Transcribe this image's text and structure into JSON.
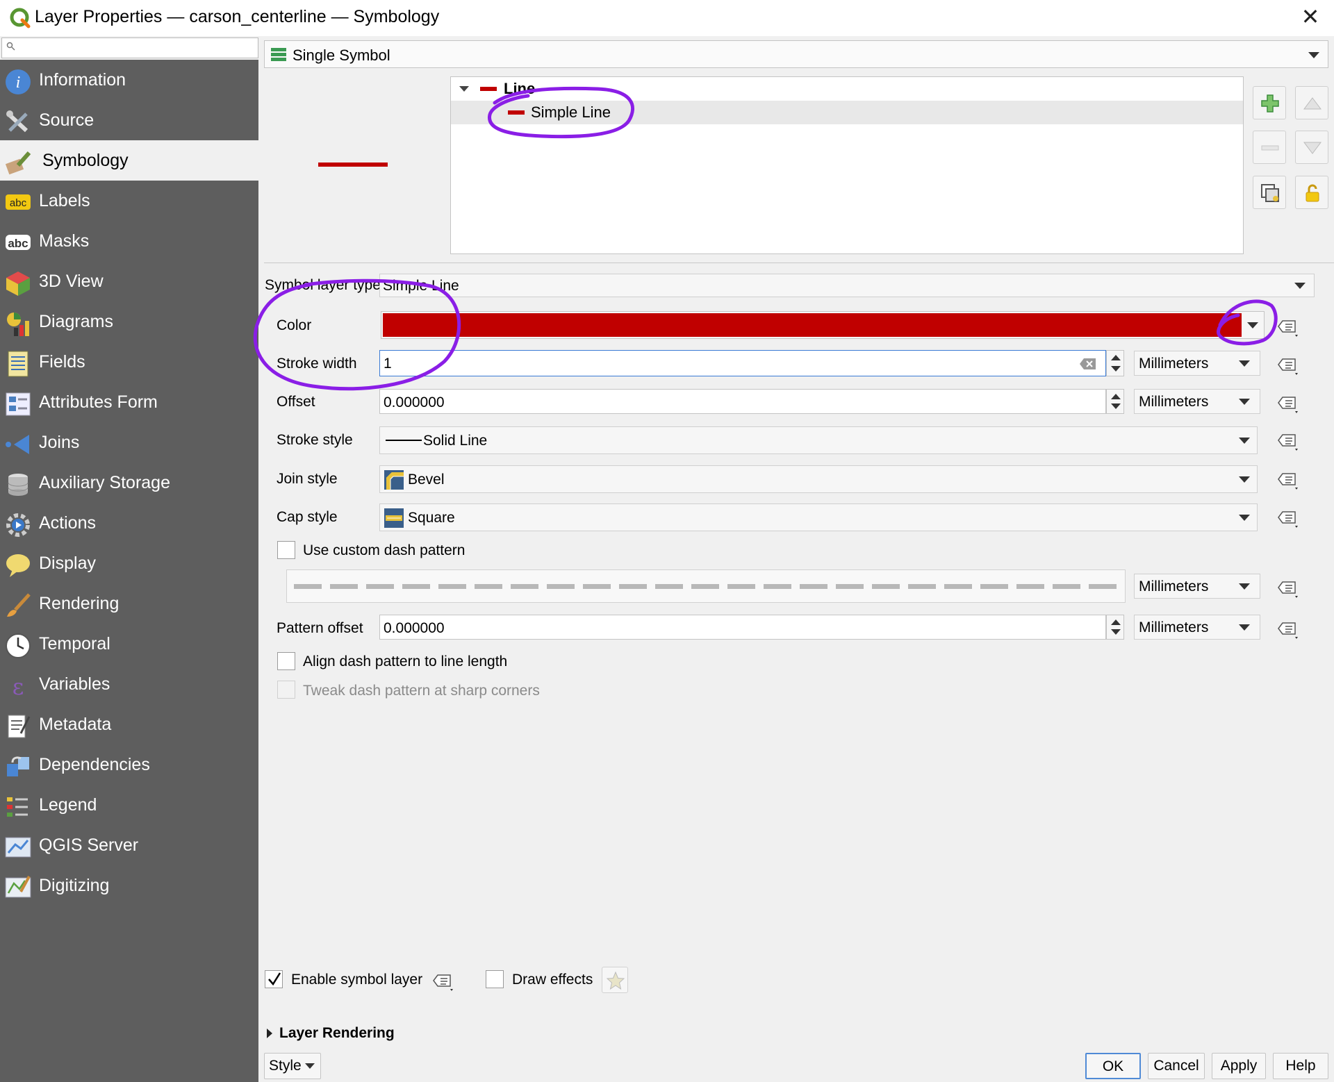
{
  "window": {
    "title": "Layer Properties — carson_centerline — Symbology",
    "close_label": "✕"
  },
  "sidebar": {
    "search_placeholder": "",
    "items": [
      {
        "label": "Information",
        "icon": "info-icon"
      },
      {
        "label": "Source",
        "icon": "source-tools-icon"
      },
      {
        "label": "Symbology",
        "icon": "paintbrush-icon",
        "active": true
      },
      {
        "label": "Labels",
        "icon": "labels-abc-icon"
      },
      {
        "label": "Masks",
        "icon": "masks-abc-icon"
      },
      {
        "label": "3D View",
        "icon": "cube-3d-icon"
      },
      {
        "label": "Diagrams",
        "icon": "diagrams-icon"
      },
      {
        "label": "Fields",
        "icon": "fields-icon"
      },
      {
        "label": "Attributes Form",
        "icon": "attributes-form-icon"
      },
      {
        "label": "Joins",
        "icon": "joins-icon"
      },
      {
        "label": "Auxiliary Storage",
        "icon": "database-icon"
      },
      {
        "label": "Actions",
        "icon": "actions-gear-icon"
      },
      {
        "label": "Display",
        "icon": "speech-bubble-icon"
      },
      {
        "label": "Rendering",
        "icon": "brush-icon"
      },
      {
        "label": "Temporal",
        "icon": "clock-icon"
      },
      {
        "label": "Variables",
        "icon": "epsilon-icon"
      },
      {
        "label": "Metadata",
        "icon": "metadata-icon"
      },
      {
        "label": "Dependencies",
        "icon": "dependencies-icon"
      },
      {
        "label": "Legend",
        "icon": "legend-icon"
      },
      {
        "label": "QGIS Server",
        "icon": "server-map-icon"
      },
      {
        "label": "Digitizing",
        "icon": "digitizing-icon"
      }
    ]
  },
  "renderer": {
    "value": "Single Symbol"
  },
  "symbol_tree": {
    "root_label": "Line",
    "child_label": "Simple Line"
  },
  "symbol_layer": {
    "type_label": "Symbol layer type",
    "type_value": "Simple Line",
    "color_label": "Color",
    "color_value": "#c00000",
    "stroke_width_label": "Stroke width",
    "stroke_width_value": "1",
    "stroke_width_unit": "Millimeters",
    "offset_label": "Offset",
    "offset_value": "0.000000",
    "offset_unit": "Millimeters",
    "stroke_style_label": "Stroke style",
    "stroke_style_value": "Solid Line",
    "join_style_label": "Join style",
    "join_style_value": "Bevel",
    "cap_style_label": "Cap style",
    "cap_style_value": "Square",
    "custom_dash_label": "Use custom dash pattern",
    "custom_dash_checked": false,
    "dash_unit": "Millimeters",
    "pattern_offset_label": "Pattern offset",
    "pattern_offset_value": "0.000000",
    "pattern_offset_unit": "Millimeters",
    "align_dash_label": "Align dash pattern to line length",
    "tweak_dash_label": "Tweak dash pattern at sharp corners"
  },
  "footer": {
    "enable_symbol_layer_label": "Enable symbol layer",
    "enable_symbol_layer_checked": true,
    "draw_effects_label": "Draw effects",
    "layer_rendering_label": "Layer Rendering",
    "style_label": "Style",
    "ok_label": "OK",
    "cancel_label": "Cancel",
    "apply_label": "Apply",
    "help_label": "Help"
  },
  "colors": {
    "sidebar_bg": "#5e5e5e",
    "symbol_red": "#c00000",
    "annotation_purple": "#8a1ee6"
  }
}
